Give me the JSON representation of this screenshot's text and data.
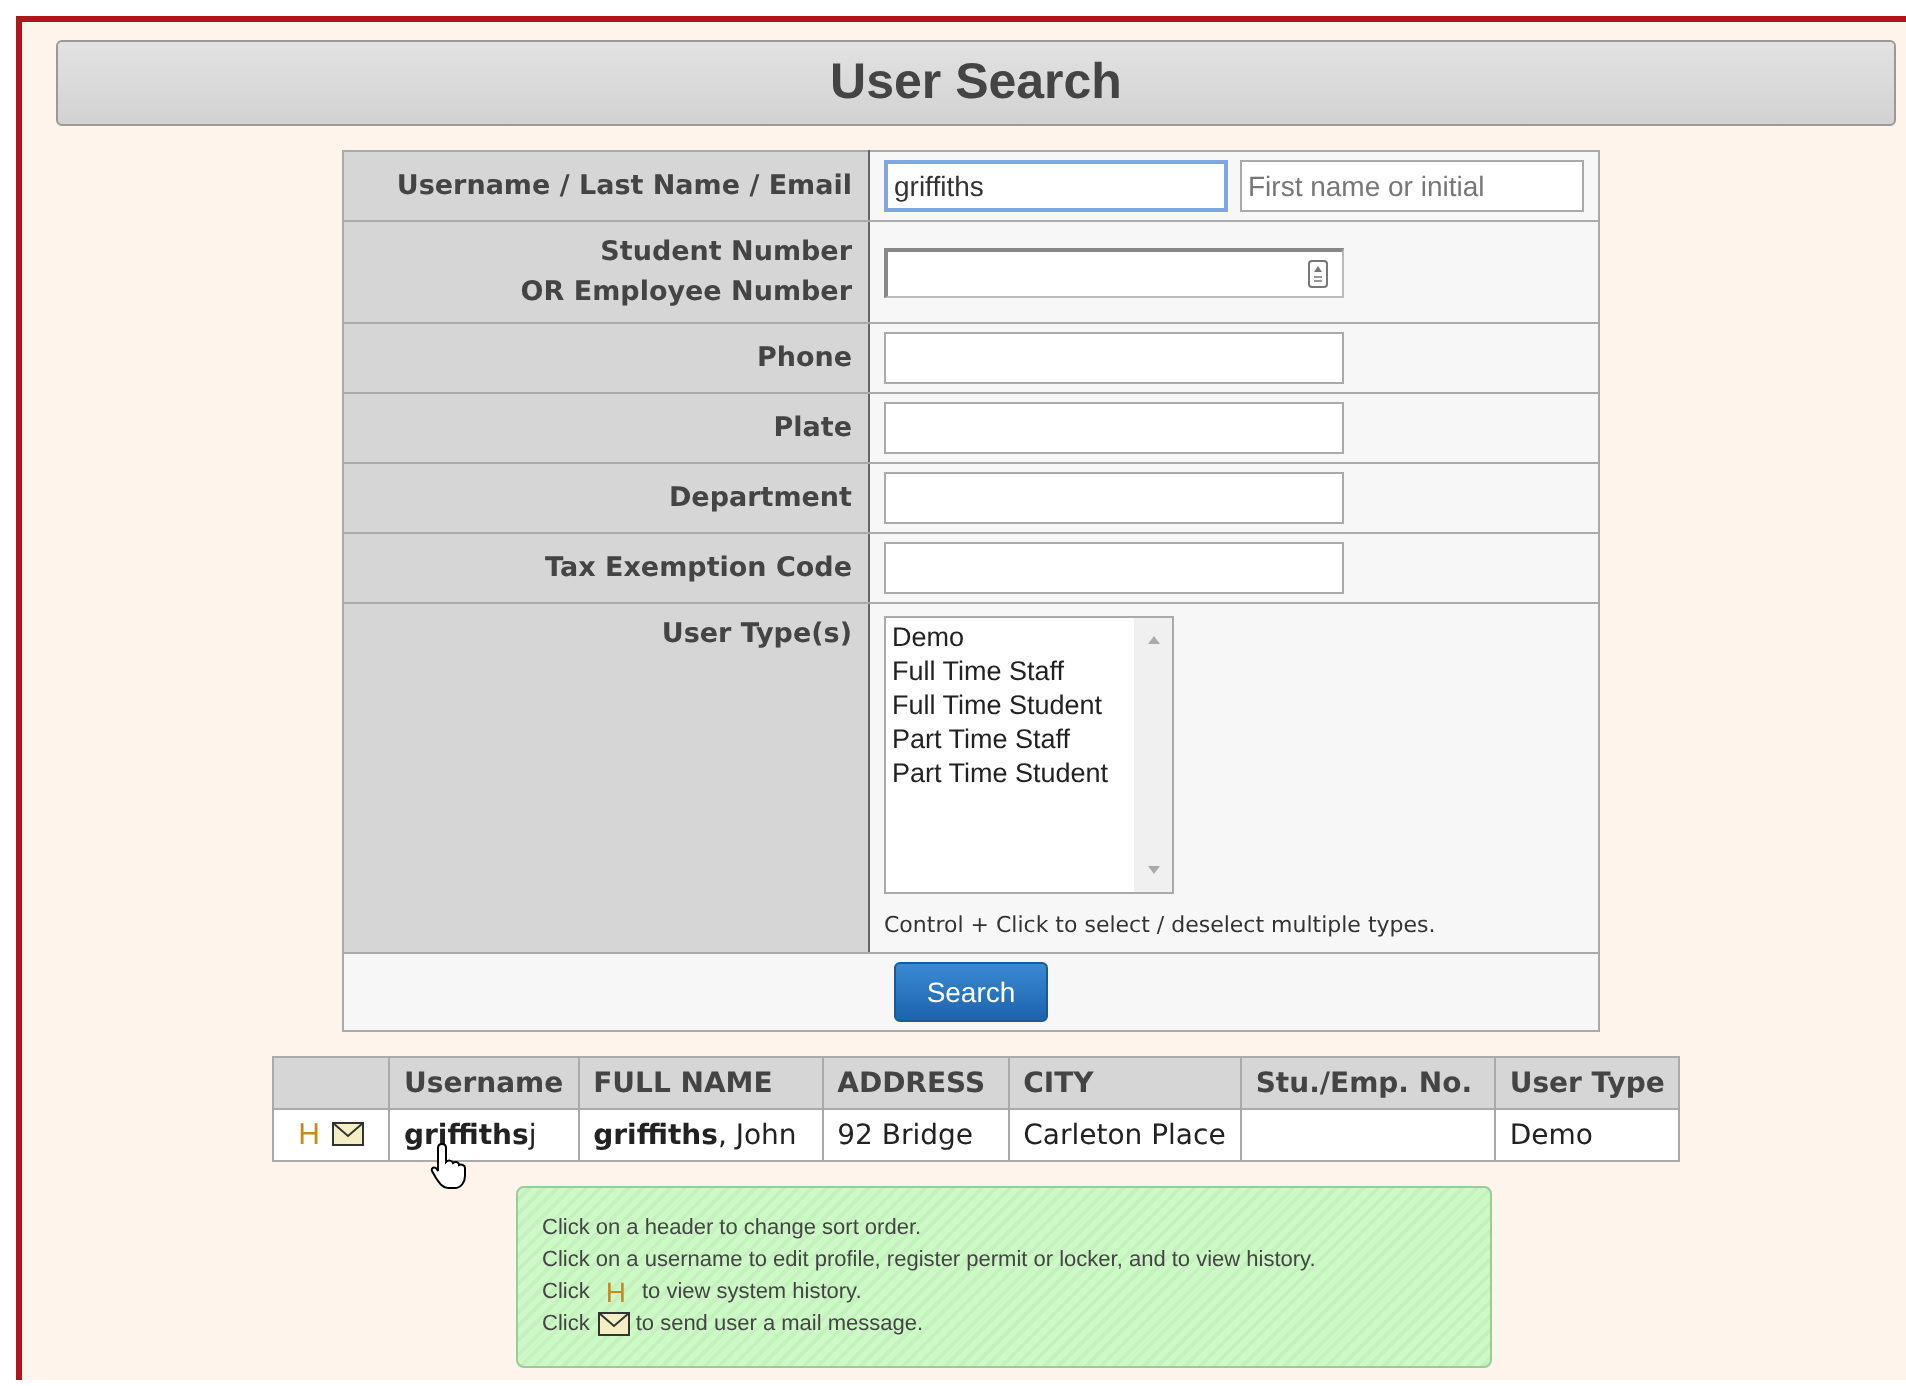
{
  "title": "User Search",
  "form": {
    "rows": [
      {
        "kind": "name",
        "label": "Username / Last Name / Email",
        "value": "griffiths",
        "placeholder": "First name or initial"
      },
      {
        "kind": "number",
        "label": "Student Number\nOR Employee Number"
      },
      {
        "kind": "text",
        "label": "Phone"
      },
      {
        "kind": "text",
        "label": "Plate"
      },
      {
        "kind": "text",
        "label": "Department"
      },
      {
        "kind": "text",
        "label": "Tax Exemption Code"
      },
      {
        "kind": "list",
        "label": "User Type(s)",
        "options": [
          {
            "label": "Demo",
            "selected": false
          },
          {
            "label": "Full Time Staff",
            "selected": false
          },
          {
            "label": "Full Time Student",
            "selected": false
          },
          {
            "label": "Part Time Staff",
            "selected": false
          },
          {
            "label": "Part Time Student",
            "selected": false
          }
        ],
        "hint": "Control + Click to select / deselect multiple types."
      }
    ],
    "button": "Search"
  },
  "results": {
    "columns": [
      "Username",
      "FULL NAME",
      "ADDRESS",
      "CITY",
      "Stu./Emp. No.",
      "User Type"
    ],
    "rows": [
      {
        "history": "H",
        "username": "**griffiths**j",
        "full_name": "**griffiths**, John",
        "address": "92 Bridge",
        "city": "Carleton Place",
        "number": "",
        "user_type": "Demo"
      }
    ]
  },
  "help": {
    "lines": [
      {
        "kind": "text",
        "text": "Click on a header to change sort order."
      },
      {
        "kind": "text",
        "text": "Click on a username to edit profile, register permit or locker, and to view history."
      },
      {
        "kind": "history",
        "before": "Click",
        "glyph": "H",
        "after": "to view system history."
      },
      {
        "kind": "mail",
        "before": "Click",
        "after": "to send user a mail message."
      }
    ]
  }
}
